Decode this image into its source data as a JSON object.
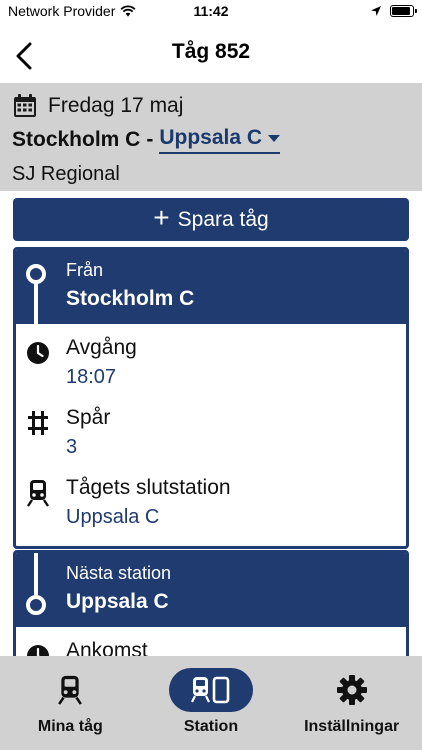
{
  "status_bar": {
    "carrier": "Network Provider",
    "time": "11:42"
  },
  "header": {
    "title": "Tåg 852"
  },
  "trip": {
    "date": "Fredag 17 maj",
    "from": "Stockholm C",
    "separator": "-",
    "to": "Uppsala C",
    "operator": "SJ Regional"
  },
  "actions": {
    "save_label": "Spara tåg"
  },
  "departure_card": {
    "label": "Från",
    "station": "Stockholm C",
    "rows": [
      {
        "label": "Avgång",
        "value": "18:07",
        "icon": "clock-icon"
      },
      {
        "label": "Spår",
        "value": "3",
        "icon": "track-icon"
      },
      {
        "label": "Tågets slutstation",
        "value": "Uppsala C",
        "icon": "train-icon"
      }
    ]
  },
  "next_card": {
    "label": "Nästa station",
    "station": "Uppsala C",
    "rows": [
      {
        "label": "Ankomst",
        "icon": "clock-icon"
      }
    ]
  },
  "tabs": [
    {
      "label": "Mina tåg",
      "icon": "train-icon",
      "active": false
    },
    {
      "label": "Station",
      "icon": "station-icon",
      "active": true
    },
    {
      "label": "Inställningar",
      "icon": "gear-icon",
      "active": false
    }
  ],
  "colors": {
    "primary": "#1f3b6f",
    "surface_gray": "#d1d1d1"
  }
}
